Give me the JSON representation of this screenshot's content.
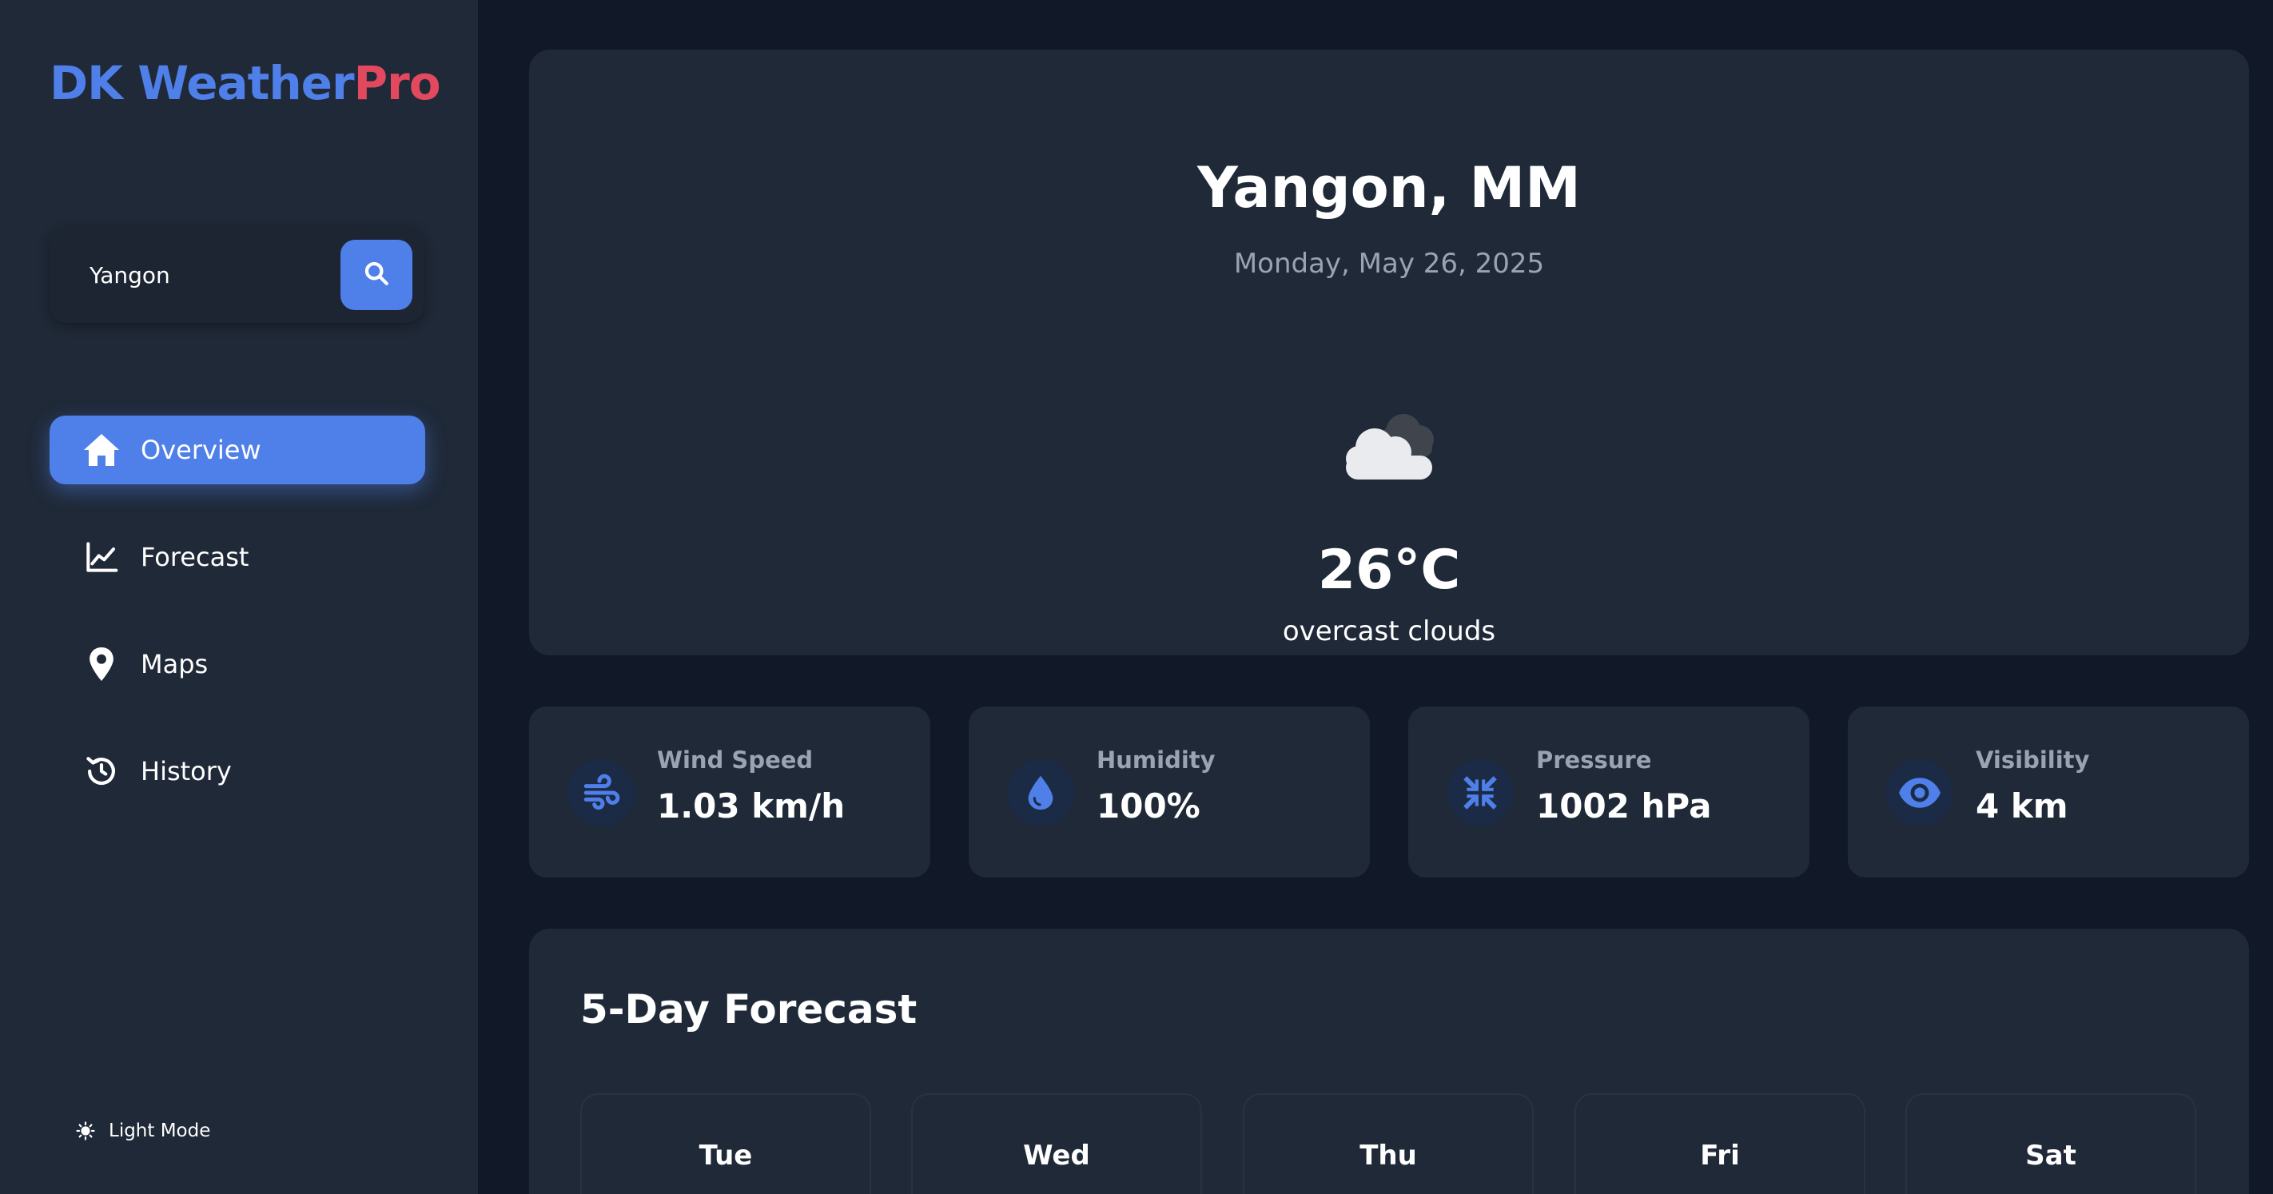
{
  "app": {
    "logo_part1": "DK Weather",
    "logo_part2": "Pro",
    "brand_color": "#4f7fe8",
    "accent_color": "#e2485e"
  },
  "search": {
    "value": "Yangon",
    "icon": "search-icon"
  },
  "nav": {
    "items": [
      {
        "label": "Overview",
        "icon": "home-icon",
        "active": true
      },
      {
        "label": "Forecast",
        "icon": "chart-line-icon",
        "active": false
      },
      {
        "label": "Maps",
        "icon": "map-pin-icon",
        "active": false
      },
      {
        "label": "History",
        "icon": "history-icon",
        "active": false
      }
    ]
  },
  "theme_toggle": {
    "label": "Light Mode",
    "icon": "sun-icon"
  },
  "current": {
    "city": "Yangon, MM",
    "date": "Monday, May 26, 2025",
    "icon": "cloud-icon",
    "temperature": "26°C",
    "description": "overcast clouds"
  },
  "stats": [
    {
      "label": "Wind Speed",
      "value": "1.03 km/h",
      "icon": "wind-icon"
    },
    {
      "label": "Humidity",
      "value": "100%",
      "icon": "droplet-icon"
    },
    {
      "label": "Pressure",
      "value": "1002 hPa",
      "icon": "compress-icon"
    },
    {
      "label": "Visibility",
      "value": "4 km",
      "icon": "eye-icon"
    }
  ],
  "forecast": {
    "title": "5-Day Forecast",
    "days": [
      {
        "day": "Tue"
      },
      {
        "day": "Wed"
      },
      {
        "day": "Thu"
      },
      {
        "day": "Fri"
      },
      {
        "day": "Sat"
      }
    ]
  }
}
